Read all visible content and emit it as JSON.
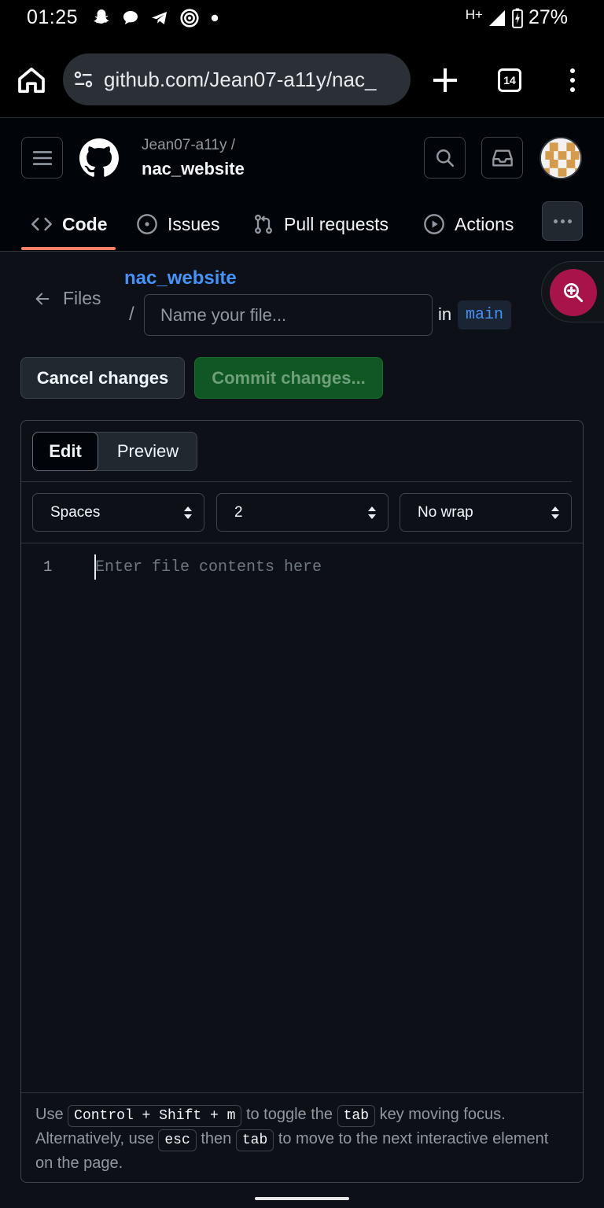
{
  "status_bar": {
    "time": "01:25",
    "network": "H+",
    "battery": "27%",
    "icons": [
      "snapchat-icon",
      "chat-icon",
      "telegram-icon",
      "hotspot-icon",
      "dot-icon"
    ]
  },
  "browser": {
    "url": "github.com/Jean07-a11y/nac_",
    "tab_count": "14"
  },
  "header": {
    "owner": "Jean07-a11y /",
    "repo": "nac_website"
  },
  "repo_tabs": [
    {
      "label": "Code",
      "icon": "code-icon"
    },
    {
      "label": "Issues",
      "icon": "issue-icon"
    },
    {
      "label": "Pull requests",
      "icon": "pull-request-icon"
    },
    {
      "label": "Actions",
      "icon": "play-icon"
    }
  ],
  "new_file": {
    "back_label": "Files",
    "repo_link": "nac_website",
    "separator": "/",
    "filename_placeholder": "Name your file...",
    "in_label": "in",
    "branch": "main"
  },
  "actions": {
    "cancel": "Cancel changes",
    "commit": "Commit changes..."
  },
  "editor": {
    "tabs": {
      "edit": "Edit",
      "preview": "Preview"
    },
    "indent_mode": "Spaces",
    "indent_size": "2",
    "wrap_mode": "No wrap",
    "line_number": "1",
    "placeholder": "Enter file contents here"
  },
  "help": {
    "t1": "Use",
    "k1": "Control + Shift + m",
    "t2": "to toggle the",
    "k2": "tab",
    "t3": "key moving focus. Alternatively, use",
    "k3": "esc",
    "t4": "then",
    "k4": "tab",
    "t5": "to move to the next interactive element on the page."
  },
  "colors": {
    "accent_link": "#4493f8",
    "commit_green": "#105823",
    "tab_underline": "#f78166",
    "zoom_fab": "#a8144a"
  }
}
